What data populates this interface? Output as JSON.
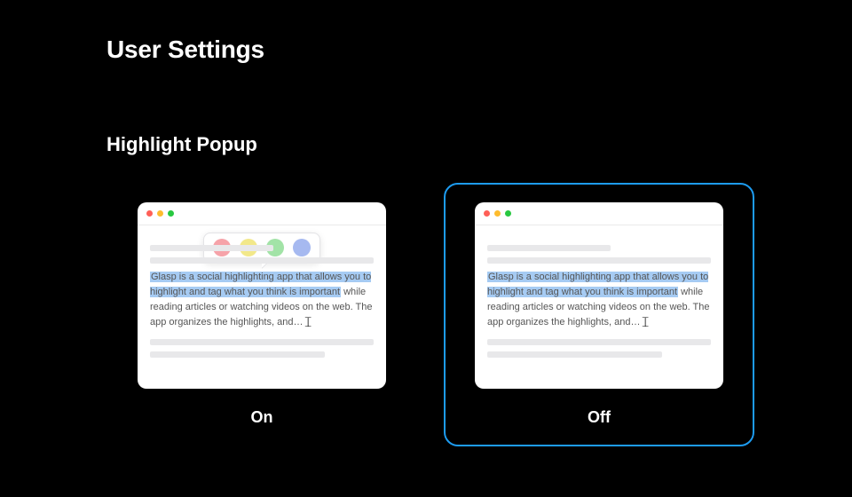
{
  "page_title": "User Settings",
  "section": {
    "title": "Highlight Popup",
    "options": [
      {
        "id": "on",
        "label": "On",
        "selected": false,
        "show_popup": true
      },
      {
        "id": "off",
        "label": "Off",
        "selected": true,
        "show_popup": false
      }
    ],
    "popup_colors": [
      "pink",
      "yellow",
      "green",
      "blue"
    ],
    "sample_paragraph": {
      "highlighted": "Glasp is a social highlighting app that allows you to highlight and tag what you think is important",
      "rest": " while reading articles or watching videos on the web. The app organizes the highlights, and…"
    }
  }
}
